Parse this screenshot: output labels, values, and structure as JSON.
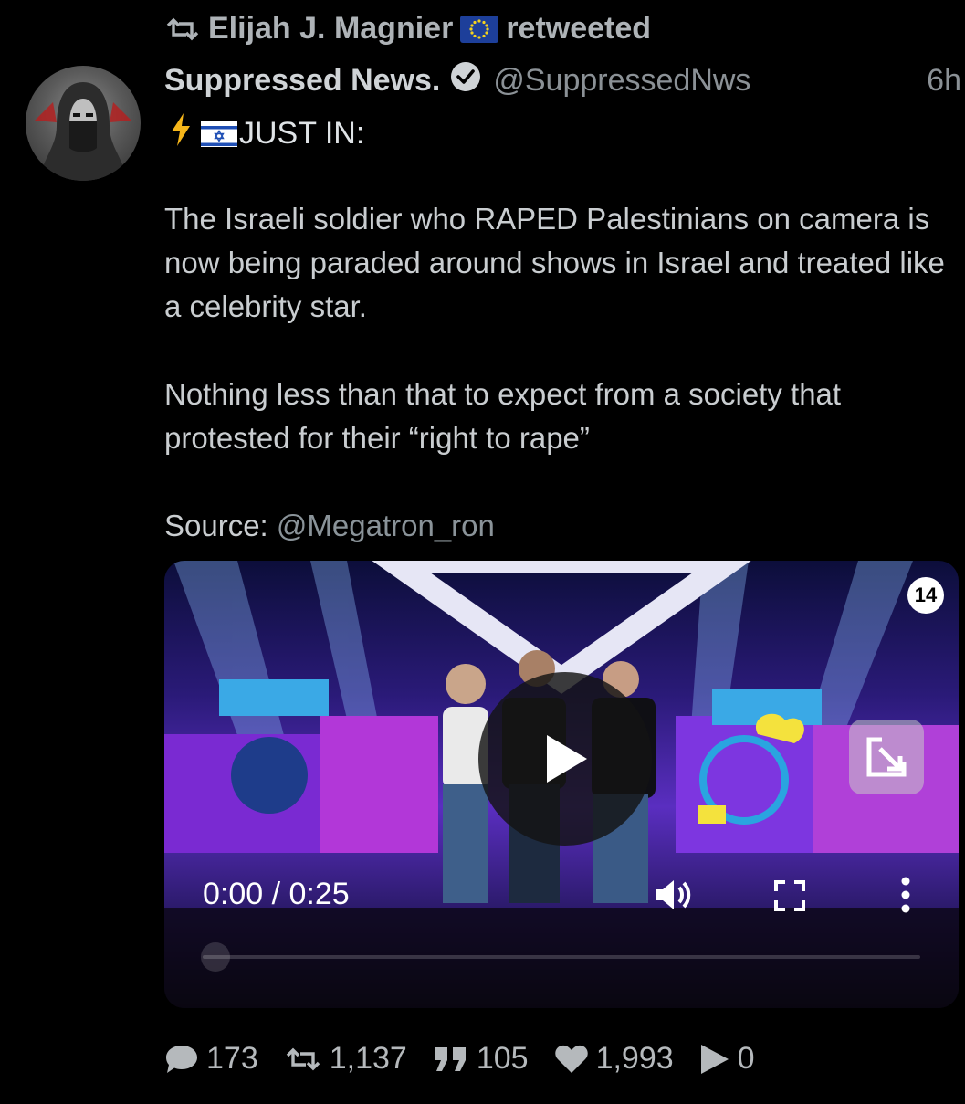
{
  "retweet_banner": {
    "user": "Elijah J. Magnier",
    "suffix": "retweeted"
  },
  "tweet": {
    "display_name": "Suppressed News.",
    "handle": "@SuppressedNws",
    "time": "6h",
    "first_line": "JUST IN:",
    "paragraph1": "The Israeli soldier who RAPED Palestinians on camera is now being paraded around shows in Israel and treated like a celebrity star.",
    "paragraph2": "Nothing less than that to expect from a society that protested for their “right to rape”",
    "source_label": "Source: ",
    "source_mention": "@Megatron_ron"
  },
  "video": {
    "channel_logo": "14",
    "time_readout": "0:00 / 0:25",
    "progress": 0
  },
  "actions": {
    "replies": "173",
    "retweets": "1,137",
    "quotes": "105",
    "likes": "1,993",
    "views": "0"
  },
  "icons": {
    "retweet": "retweet-icon",
    "verified": "verified-badge-icon",
    "bolt": "lightning-icon",
    "play": "play-icon",
    "volume": "volume-icon",
    "fullscreen": "fullscreen-icon",
    "more": "more-vertical-icon",
    "pip": "picture-in-picture-icon",
    "reply": "reply-bubble-icon",
    "quote": "quote-icon",
    "like": "heart-icon",
    "views": "play-triangle-icon"
  }
}
